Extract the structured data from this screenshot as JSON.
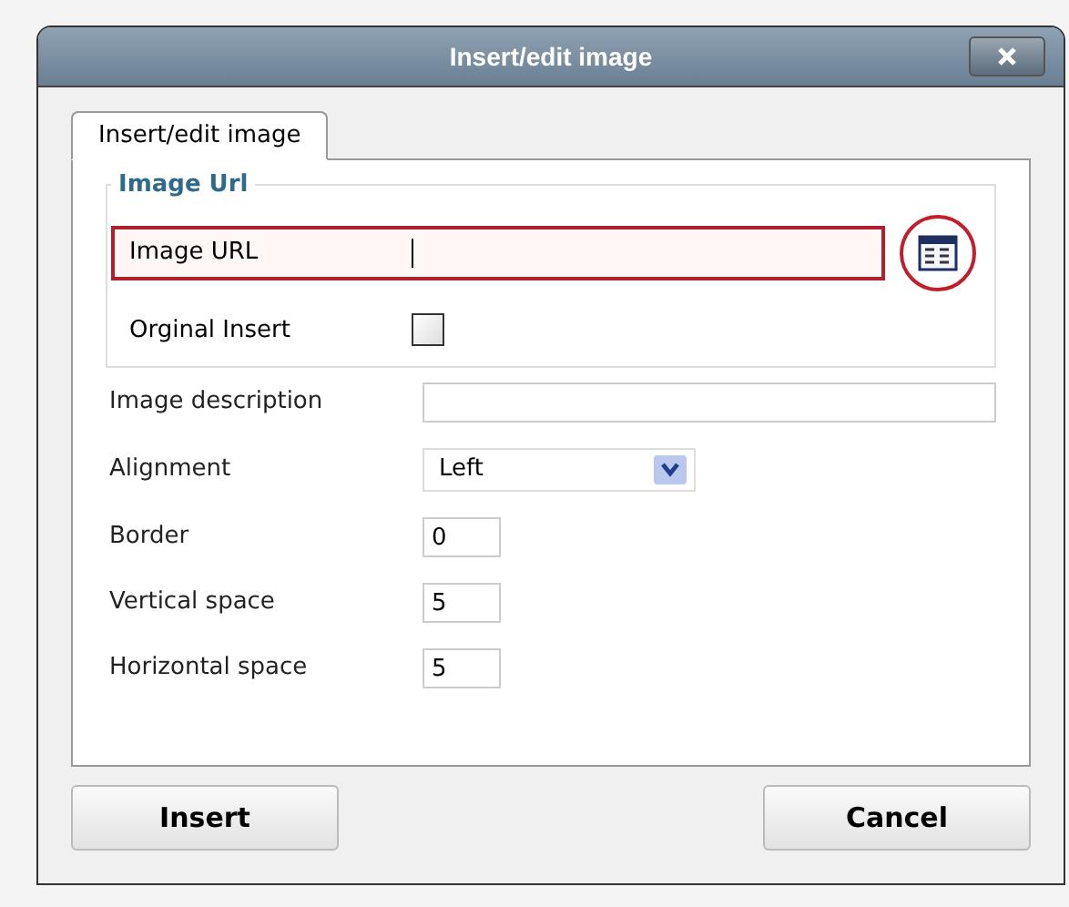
{
  "dialog": {
    "title": "Insert/edit image"
  },
  "tabs": [
    {
      "label": "Insert/edit image",
      "selected": true
    }
  ],
  "image_url_group": {
    "legend": "Image Url",
    "url_field": {
      "label": "Image URL",
      "highlighted": true,
      "focused": true
    },
    "browse_button": {
      "highlighted": true
    },
    "original_insert": {
      "label": "Orginal Insert",
      "checked": false
    }
  },
  "fields": [
    {
      "label": "Image description",
      "kind": "long_text"
    },
    {
      "label": "Alignment",
      "kind": "select",
      "value": "Left"
    },
    {
      "label": "Border",
      "kind": "short_text",
      "value": "0"
    },
    {
      "label": "Vertical space",
      "kind": "short_text",
      "value": "5"
    },
    {
      "label": "Horizontal space",
      "kind": "short_text",
      "value": "5"
    }
  ],
  "buttons": [
    {
      "label": "Insert"
    },
    {
      "label": "Cancel"
    }
  ]
}
